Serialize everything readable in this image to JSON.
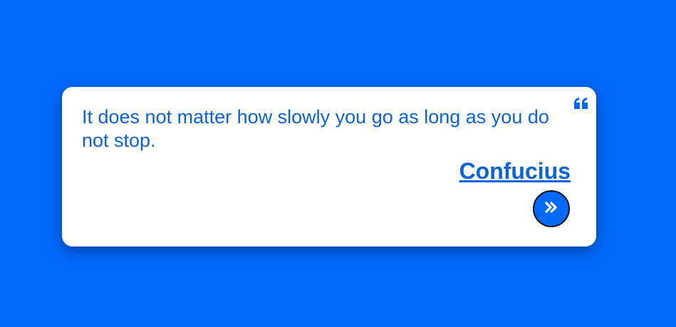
{
  "quote": {
    "text": "It does not matter how slowly you go as long as you do not stop.",
    "author": "Confucius"
  },
  "icons": {
    "quote": "quote-left-icon",
    "next": "double-chevron-right-icon"
  },
  "colors": {
    "background": "#0069fa",
    "text": "#0a63d8",
    "card": "#ffffff"
  }
}
